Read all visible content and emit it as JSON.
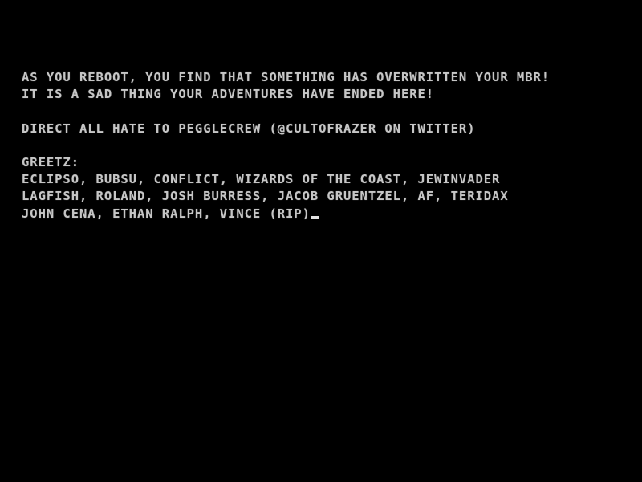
{
  "screen": {
    "background_color": "#000000",
    "text_color": "#c6c6c6",
    "cursor_color": "#e2e2e2",
    "mode": "text-console"
  },
  "console": {
    "message": {
      "line1": "AS YOU REBOOT, YOU FIND THAT SOMETHING HAS OVERWRITTEN YOUR MBR!",
      "line2": "IT IS A SAD THING YOUR ADVENTURES HAVE ENDED HERE!"
    },
    "contact": {
      "line": "DIRECT ALL HATE TO PEGGLECREW (@CULTOFRAZER ON TWITTER)",
      "crew": "PEGGLECREW",
      "handle": "@CULTOFRAZER",
      "platform": "TWITTER"
    },
    "greetz": {
      "heading": "GREETZ:",
      "line1": "ECLIPSO, BUBSU, CONFLICT, WIZARDS OF THE COAST, JEWINVADER",
      "line2": "LAGFISH, ROLAND, JOSH BURRESS, JACOB GRUENTZEL, AF, TERIDAX",
      "line3": "JOHN CENA, ETHAN RALPH, VINCE (RIP)",
      "names": [
        "ECLIPSO",
        "BUBSU",
        "CONFLICT",
        "WIZARDS OF THE COAST",
        "JEWINVADER",
        "LAGFISH",
        "ROLAND",
        "JOSH BURRESS",
        "JACOB GRUENTZEL",
        "AF",
        "TERIDAX",
        "JOHN CENA",
        "ETHAN RALPH",
        "VINCE (RIP)"
      ]
    },
    "blank": " "
  }
}
